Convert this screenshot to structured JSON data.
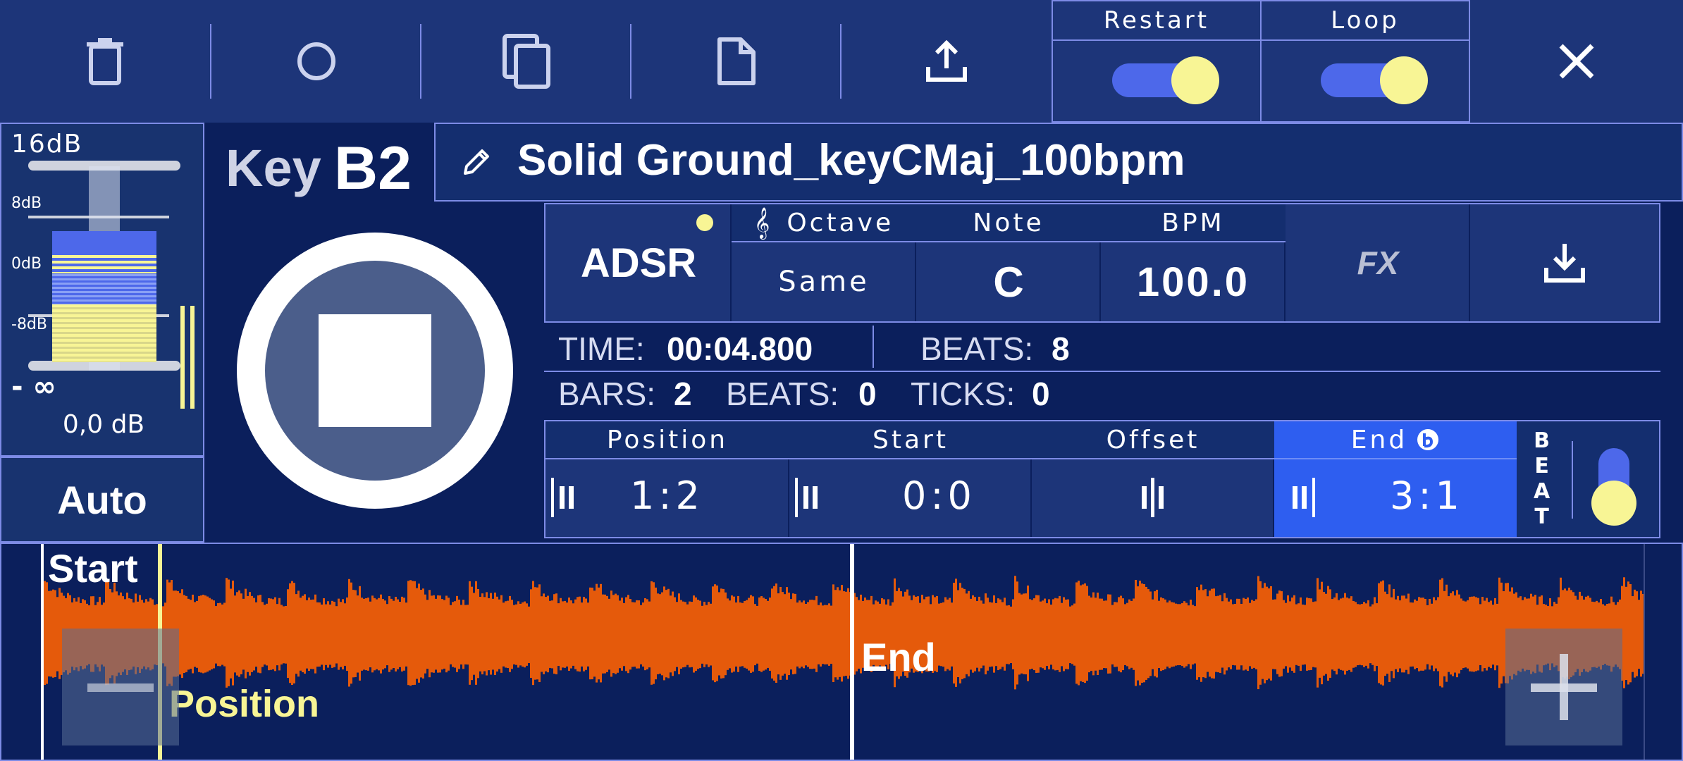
{
  "toolbar": {
    "icons": [
      "trash-icon",
      "record-icon",
      "copy-icon",
      "file-icon",
      "share-icon"
    ],
    "restart_label": "Restart",
    "restart_on": true,
    "loop_label": "Loop",
    "loop_on": true,
    "close_icon": "close-icon"
  },
  "meter": {
    "scale": [
      "16dB",
      "8dB",
      "0dB",
      "-8dB",
      "- ∞"
    ],
    "value": "0,0 dB",
    "auto_label": "Auto"
  },
  "key": {
    "label": "Key",
    "value": "B2"
  },
  "sample": {
    "title": "Solid Ground_keyCMaj_100bpm"
  },
  "params": {
    "adsr_label": "ADSR",
    "octave_label": "Octave",
    "octave_value": "Same",
    "note_label": "Note",
    "note_value": "C",
    "bpm_label": "BPM",
    "bpm_value": "100.0",
    "fx_label": "FX"
  },
  "info": {
    "time_label": "TIME:",
    "time_value": "00:04.800",
    "beats_label": "BEATS:",
    "beats_value": "8",
    "bars_label": "BARS:",
    "bars_value": "2",
    "beats2_label": "BEATS:",
    "beats2_value": "0",
    "ticks_label": "TICKS:",
    "ticks_value": "0"
  },
  "markers": {
    "position_label": "Position",
    "position_value": "1:2",
    "start_label": "Start",
    "start_value": "0:0",
    "offset_label": "Offset",
    "end_label": "End",
    "end_value": "3:1",
    "beat_letters": [
      "B",
      "E",
      "A",
      "T"
    ],
    "beat_snap_on": true
  },
  "waveform": {
    "start_label": "Start",
    "position_label": "Position",
    "end_label": "End",
    "colors": {
      "wave": "#e55a0b",
      "position": "#f8f595",
      "marker": "#ffffff"
    }
  }
}
